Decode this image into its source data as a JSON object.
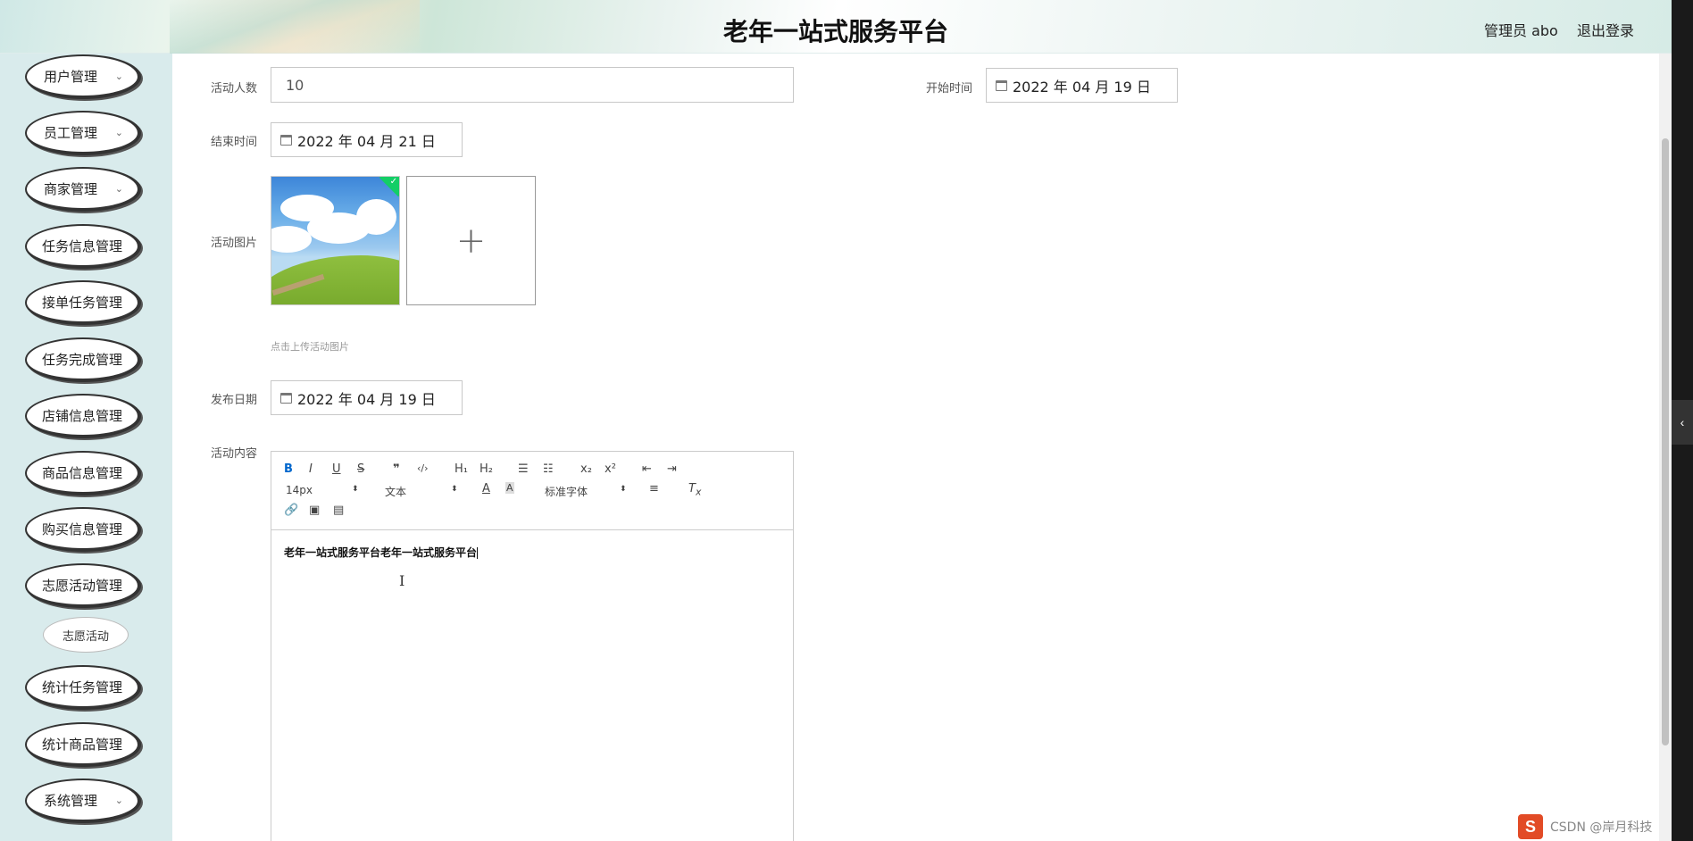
{
  "header": {
    "title": "老年一站式服务平台",
    "admin_label": "管理员 abo",
    "logout_label": "退出登录"
  },
  "sidebar": {
    "items": [
      {
        "label": "用户管理",
        "has_chevron": true
      },
      {
        "label": "员工管理",
        "has_chevron": true
      },
      {
        "label": "商家管理",
        "has_chevron": true
      },
      {
        "label": "任务信息管理",
        "has_chevron": false
      },
      {
        "label": "接单任务管理",
        "has_chevron": false
      },
      {
        "label": "任务完成管理",
        "has_chevron": false
      },
      {
        "label": "店铺信息管理",
        "has_chevron": false
      },
      {
        "label": "商品信息管理",
        "has_chevron": false
      },
      {
        "label": "购买信息管理",
        "has_chevron": false
      },
      {
        "label": "志愿活动管理",
        "has_chevron": false
      },
      {
        "label": "统计任务管理",
        "has_chevron": false
      },
      {
        "label": "统计商品管理",
        "has_chevron": false
      },
      {
        "label": "系统管理",
        "has_chevron": true
      }
    ],
    "sub_item": "志愿活动",
    "chevron_glyph": "⌄"
  },
  "form": {
    "participants_label": "活动人数",
    "participants_value": "10",
    "start_time_label": "开始时间",
    "start_time_value": "2022 年 04 月 19 日",
    "end_time_label": "结束时间",
    "end_time_value": "2022 年 04 月 21 日",
    "image_label": "活动图片",
    "upload_hint": "点击上传活动图片",
    "publish_date_label": "发布日期",
    "publish_date_value": "2022 年 04 月 19 日",
    "content_label": "活动内容"
  },
  "editor": {
    "toolbar_row1": [
      "B",
      "I",
      "U",
      "S",
      "❞",
      "‹/›",
      "H₁",
      "H₂",
      "☰",
      "☷",
      "x₂",
      "x²",
      "⇤",
      "⇥"
    ],
    "size_select": "14px",
    "format_select": "文本",
    "font_select": "标准字体",
    "content_text": "老年一站式服务平台老年一站式服务平台"
  },
  "watermark": {
    "logo": "S",
    "text": "CSDN @岸月科技"
  },
  "colors": {
    "sidebar_bg": "#d9ebec",
    "active_toolbar": "#0066cc",
    "upload_success": "#13ce66"
  }
}
